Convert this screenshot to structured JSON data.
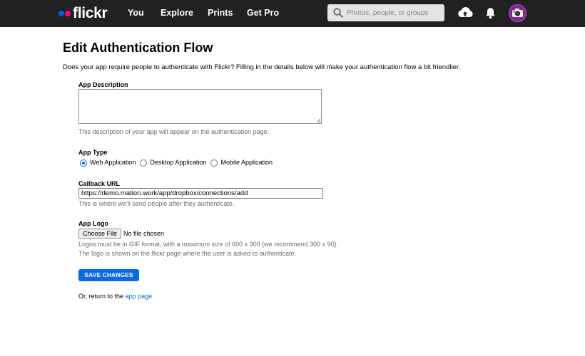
{
  "nav": {
    "logo_text": "flickr",
    "items": [
      "You",
      "Explore",
      "Prints",
      "Get Pro"
    ],
    "search_placeholder": "Photos, people, or groups",
    "icons": [
      "search-icon",
      "upload-icon",
      "bell-icon",
      "avatar"
    ]
  },
  "page": {
    "title": "Edit Authentication Flow",
    "intro": "Does your app require people to authenticate with Flickr? Filling in the details below will make your authentication flow a bit friendlier."
  },
  "form": {
    "description": {
      "label": "App Description",
      "value": "",
      "help": "This description of your app will appear on the authentication page."
    },
    "app_type": {
      "label": "App Type",
      "options": [
        "Web Application",
        "Desktop Application",
        "Mobile Application"
      ],
      "selected": "Web Application"
    },
    "callback": {
      "label": "Callback URL",
      "value": "https://demo.mation.work/app/dropbox/connections/add",
      "help": "This is where we'll send people after they authenticate."
    },
    "logo": {
      "label": "App Logo",
      "button": "Choose File",
      "status": "No file chosen",
      "help1": "Logos must be in GIF format, with a maximum size of 600 x 300 (we recommend 300 x 90).",
      "help2": "The logo is shown on the flickr page where the user is asked to authenticate."
    },
    "save_label": "SAVE CHANGES",
    "return_prefix": "Or, return to the",
    "return_link": "app page"
  },
  "colors": {
    "nav_bg": "#212124",
    "flickr_blue": "#0063dc",
    "flickr_pink": "#ff0084",
    "button": "#0a68e0",
    "link": "#006add"
  }
}
